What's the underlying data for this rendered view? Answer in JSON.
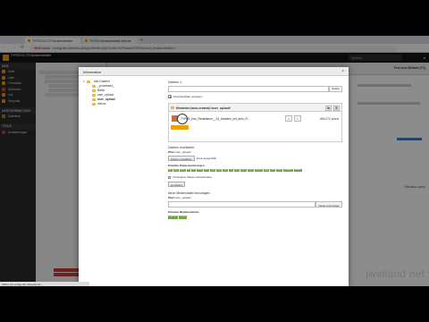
{
  "browser": {
    "tabs": [
      {
        "label": "TYPO3 8 LTS Musterwebsite"
      },
      {
        "label": "TYPO3 Musterwebsite test.ter"
      }
    ],
    "url_warning": "Nicht sicher",
    "url": "verlag-der-dbneedv.de/typo3/index.php?route=%2Fwizard%2Felement_browser&token=..."
  },
  "typo3": {
    "title": "TYPO3 8 LTS Musterwebsite",
    "search_placeholder": "Suchen",
    "doc_header_title": "Text zum Medien (T1)",
    "module_groups": [
      {
        "label": "WEB",
        "items": [
          {
            "label": "Seite",
            "color": "#f49700"
          },
          {
            "label": "Liste",
            "color": "#f49700"
          },
          {
            "label": "Formulare",
            "color": "#f49700"
          },
          {
            "label": "Standorte",
            "color": "#d04535"
          },
          {
            "label": "Info",
            "color": "#f49700"
          },
          {
            "label": "Template",
            "color": "#f49700"
          }
        ]
      },
      {
        "label": "DATEIVERWALTUNG",
        "items": [
          {
            "label": "Dateiliste",
            "color": "#6b9b3a"
          }
        ]
      },
      {
        "label": "TOOLS",
        "items": [
          {
            "label": "Erweiterungen",
            "color": "#c83c3c"
          }
        ]
      }
    ],
    "bg_text_standard": "Standard-Layout",
    "status_bar": "Warte auf verlag-der-dbneedv.de..."
  },
  "modal": {
    "title": "Information",
    "tree": [
      {
        "label": "Alle Dateien",
        "level": 0,
        "bold": false
      },
      {
        "label": "_processed_",
        "level": 1,
        "bold": false
      },
      {
        "label": "Bilder",
        "level": 1,
        "bold": false
      },
      {
        "label": "user_upload",
        "level": 1,
        "bold": false
      },
      {
        "label": "user_upload",
        "level": 1,
        "bold": true
      },
      {
        "label": "videos",
        "level": 1,
        "bold": false
      }
    ],
    "filter_label": "Dateien 1:",
    "filter_button": "Suche",
    "thumbnails_label": "Vorschaubilder anzeigen",
    "folder_path": "fileadmin/ (auto-created) /user_upload/",
    "file_name": "TYPO3_fuer_Redakteure__24_Arbeiten_mit_dem_Fi...",
    "file_dims": "480x270 pixels",
    "upload_heading": "Dateien hochladen:",
    "upload_target_label": "Pfad",
    "upload_target_value": "/user_upload/",
    "choose_files_button": "Dateien auswählen",
    "no_file_text": "Keine ausgewählt",
    "extensions_heading": "Erlaubte Dateierweiterungen",
    "extensions": [
      "gif",
      "jpg",
      "jpeg",
      "tif",
      "tiff",
      "bmp",
      "pcx",
      "tga",
      "png",
      "pdf",
      "ai",
      "svg",
      "mp4",
      "mp3",
      "webm",
      "ogg",
      "flac",
      "wav",
      "youtube",
      "vimeo"
    ],
    "overwrite_label": "Vorhandene Dateien überschreiben",
    "upload_button": "Hochladen",
    "new_media_heading": "Neue Mediendatei hinzufügen:",
    "new_media_path_label": "Pfad",
    "new_media_path_value": "/user_upload/",
    "add_media_button": "Medien hinzufügen",
    "media_ext_heading": "Erlaubte Medienanbieter",
    "media_providers": [
      "Youtube",
      "Vimeo"
    ]
  },
  "watermark": {
    "main": "jweiland",
    "dot": ".",
    "tld": "net"
  },
  "colors": {
    "typo3_orange": "#f49700",
    "tag_green": "#79a548",
    "module_bg": "#2a2a2a"
  }
}
